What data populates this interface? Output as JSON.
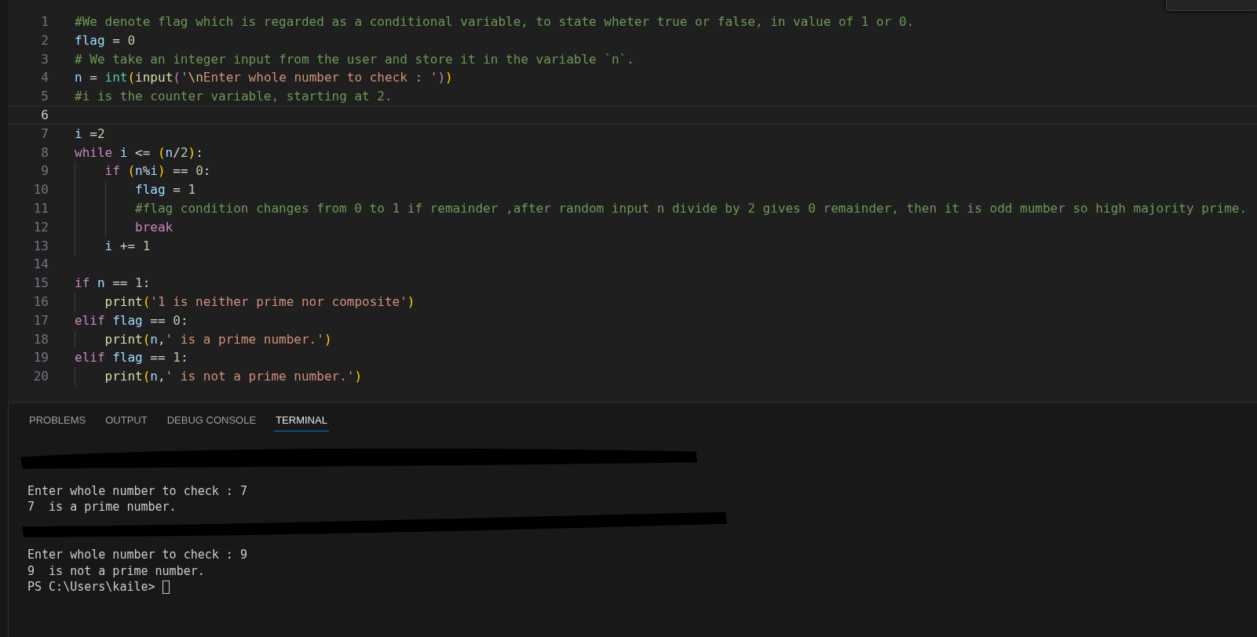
{
  "editor": {
    "lines": [
      {
        "number": "1",
        "current": false,
        "tokens": [
          {
            "kind": "comment",
            "text": "#We denote flag which is regarded as a conditional variable, to state wheter true or false, in value of 1 or 0."
          }
        ]
      },
      {
        "number": "2",
        "current": false,
        "tokens": [
          {
            "kind": "var",
            "text": "flag"
          },
          {
            "kind": "op",
            "text": " = "
          },
          {
            "kind": "num",
            "text": "0"
          }
        ]
      },
      {
        "number": "3",
        "current": false,
        "tokens": [
          {
            "kind": "comment",
            "text": "# We take an integer input from the user and store it in the variable `n`."
          }
        ]
      },
      {
        "number": "4",
        "current": false,
        "tokens": [
          {
            "kind": "var",
            "text": "n"
          },
          {
            "kind": "op",
            "text": " = "
          },
          {
            "kind": "builtin",
            "text": "int"
          },
          {
            "kind": "paren1",
            "text": "("
          },
          {
            "kind": "func",
            "text": "input"
          },
          {
            "kind": "paren2",
            "text": "("
          },
          {
            "kind": "str",
            "text": "'"
          },
          {
            "kind": "escape",
            "text": "\\n"
          },
          {
            "kind": "str",
            "text": "Enter whole number to check : '"
          },
          {
            "kind": "paren2",
            "text": ")"
          },
          {
            "kind": "paren1",
            "text": ")"
          }
        ]
      },
      {
        "number": "5",
        "current": false,
        "tokens": [
          {
            "kind": "comment",
            "text": "#i is the counter variable, starting at 2."
          }
        ]
      },
      {
        "number": "6",
        "current": true
      },
      {
        "number": "7",
        "current": false,
        "tokens": [
          {
            "kind": "var",
            "text": "i"
          },
          {
            "kind": "op",
            "text": " ="
          },
          {
            "kind": "num",
            "text": "2"
          }
        ]
      },
      {
        "number": "8",
        "current": false,
        "tokens": [
          {
            "kind": "keyword",
            "text": "while "
          },
          {
            "kind": "var",
            "text": "i"
          },
          {
            "kind": "op",
            "text": " <= "
          },
          {
            "kind": "paren1",
            "text": "("
          },
          {
            "kind": "var",
            "text": "n"
          },
          {
            "kind": "op",
            "text": "/"
          },
          {
            "kind": "num",
            "text": "2"
          },
          {
            "kind": "paren1",
            "text": ")"
          },
          {
            "kind": "op",
            "text": ":"
          }
        ]
      },
      {
        "number": "9",
        "current": false,
        "tokens": [
          {
            "kind": "keyword",
            "text": "    if "
          },
          {
            "kind": "paren1",
            "text": "("
          },
          {
            "kind": "var",
            "text": "n"
          },
          {
            "kind": "op",
            "text": "%"
          },
          {
            "kind": "var",
            "text": "i"
          },
          {
            "kind": "paren1",
            "text": ")"
          },
          {
            "kind": "op",
            "text": " == "
          },
          {
            "kind": "num",
            "text": "0"
          },
          {
            "kind": "op",
            "text": ":"
          }
        ]
      },
      {
        "number": "10",
        "current": false,
        "tokens": [
          {
            "kind": "var",
            "text": "        flag"
          },
          {
            "kind": "op",
            "text": " = "
          },
          {
            "kind": "num",
            "text": "1"
          }
        ]
      },
      {
        "number": "11",
        "current": false,
        "tokens": [
          {
            "kind": "comment",
            "text": "        #flag condition changes from 0 to 1 if remainder ,after random input n divide by 2 gives 0 remainder, then it is odd mumber so high majority prime."
          }
        ]
      },
      {
        "number": "12",
        "current": false,
        "tokens": [
          {
            "kind": "keyword",
            "text": "        break"
          }
        ]
      },
      {
        "number": "13",
        "current": false,
        "tokens": [
          {
            "kind": "var",
            "text": "    i"
          },
          {
            "kind": "op",
            "text": " += "
          },
          {
            "kind": "num",
            "text": "1"
          }
        ]
      },
      {
        "number": "14",
        "current": false
      },
      {
        "number": "15",
        "current": false,
        "tokens": [
          {
            "kind": "keyword",
            "text": "if "
          },
          {
            "kind": "var",
            "text": "n"
          },
          {
            "kind": "op",
            "text": " == "
          },
          {
            "kind": "num",
            "text": "1"
          },
          {
            "kind": "op",
            "text": ":"
          }
        ]
      },
      {
        "number": "16",
        "current": false,
        "tokens": [
          {
            "kind": "func",
            "text": "    print"
          },
          {
            "kind": "paren1",
            "text": "("
          },
          {
            "kind": "str",
            "text": "'1 is neither prime nor composite'"
          },
          {
            "kind": "paren1",
            "text": ")"
          }
        ]
      },
      {
        "number": "17",
        "current": false,
        "tokens": [
          {
            "kind": "keyword",
            "text": "elif "
          },
          {
            "kind": "var",
            "text": "flag"
          },
          {
            "kind": "op",
            "text": " == "
          },
          {
            "kind": "num",
            "text": "0"
          },
          {
            "kind": "op",
            "text": ":"
          }
        ]
      },
      {
        "number": "18",
        "current": false,
        "tokens": [
          {
            "kind": "func",
            "text": "    print"
          },
          {
            "kind": "paren1",
            "text": "("
          },
          {
            "kind": "var",
            "text": "n"
          },
          {
            "kind": "op",
            "text": ","
          },
          {
            "kind": "str",
            "text": "' is a prime number.'"
          },
          {
            "kind": "paren1",
            "text": ")"
          }
        ]
      },
      {
        "number": "19",
        "current": false,
        "tokens": [
          {
            "kind": "keyword",
            "text": "elif "
          },
          {
            "kind": "var",
            "text": "flag"
          },
          {
            "kind": "op",
            "text": " == "
          },
          {
            "kind": "num",
            "text": "1"
          },
          {
            "kind": "op",
            "text": ":"
          }
        ]
      },
      {
        "number": "20",
        "current": false,
        "tokens": [
          {
            "kind": "func",
            "text": "    print"
          },
          {
            "kind": "paren1",
            "text": "("
          },
          {
            "kind": "var",
            "text": "n"
          },
          {
            "kind": "op",
            "text": ","
          },
          {
            "kind": "str",
            "text": "' is not a prime number.'"
          },
          {
            "kind": "paren1",
            "text": ")"
          }
        ]
      }
    ]
  },
  "panel": {
    "tabs": [
      {
        "label": "PROBLEMS",
        "selected": false
      },
      {
        "label": "OUTPUT",
        "selected": false
      },
      {
        "label": "DEBUG CONSOLE",
        "selected": false
      },
      {
        "label": "TERMINAL",
        "selected": true
      }
    ],
    "terminal": {
      "lines": [
        {
          "kind": "redacted"
        },
        {
          "kind": "blank"
        },
        {
          "kind": "text",
          "text": "Enter whole number to check : 7"
        },
        {
          "kind": "text",
          "text": "7  is a prime number."
        },
        {
          "kind": "redacted"
        },
        {
          "kind": "blank"
        },
        {
          "kind": "text",
          "text": "Enter whole number to check : 9"
        },
        {
          "kind": "text",
          "text": "9  is not a prime number."
        },
        {
          "kind": "prompt",
          "text": "PS C:\\Users\\kaile>",
          "cursor": true
        }
      ]
    }
  }
}
